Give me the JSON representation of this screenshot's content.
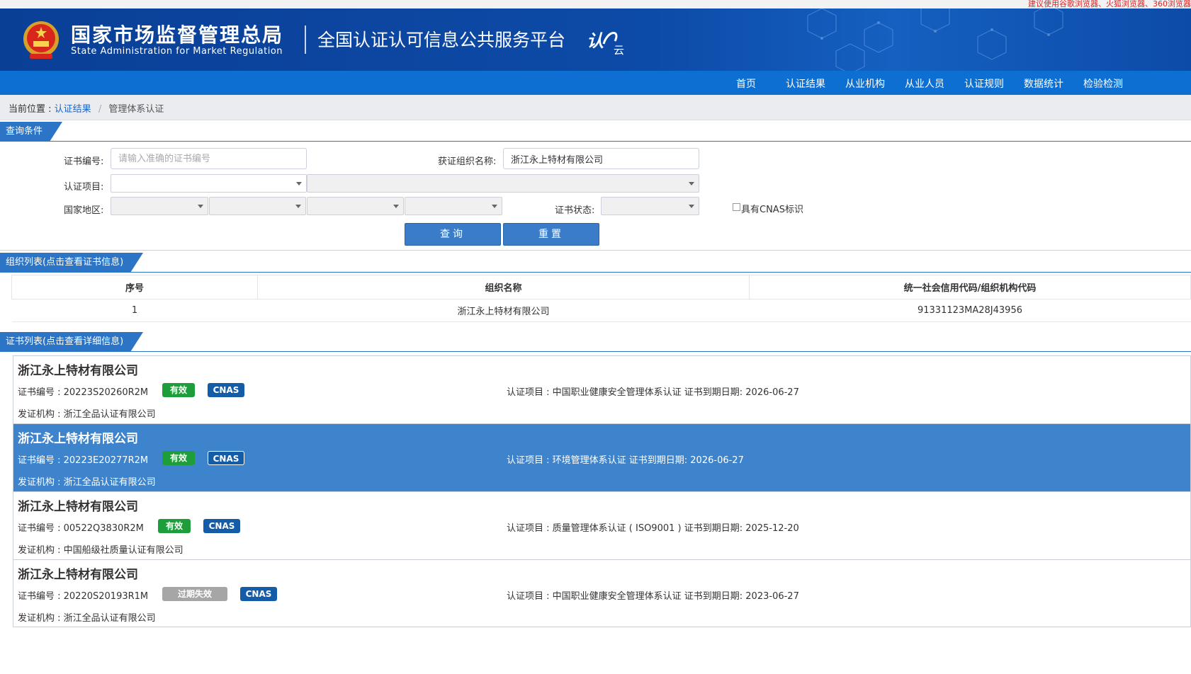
{
  "notice": "建议使用谷歌浏览器、火狐浏览器、360浏览器",
  "header": {
    "org_cn": "国家市场监督管理总局",
    "org_en": "State Administration  for  Market Regulation",
    "platform": "全国认证认可信息公共服务平台",
    "logo_text": "认云"
  },
  "nav": [
    "首页",
    "认证结果",
    "从业机构",
    "从业人员",
    "认证规则",
    "数据统计",
    "检验检测"
  ],
  "breadcrumb": {
    "label": "当前位置 :",
    "link": "认证结果",
    "separator": "/",
    "current": "管理体系认证"
  },
  "query": {
    "section_title": "查询条件",
    "cert_no_label": "证书编号:",
    "cert_no_placeholder": "请输入准确的证书编号",
    "org_name_label": "获证组织名称:",
    "org_name_value": "浙江永上特材有限公司",
    "project_label": "认证项目:",
    "region_label": "国家地区:",
    "status_label": "证书状态:",
    "cnas_label": "具有CNAS标识",
    "search_button": "查询",
    "reset_button": "重置"
  },
  "org_list": {
    "section_title": "组织列表(点击查看证书信息)",
    "columns": [
      "序号",
      "组织名称",
      "统一社会信用代码/组织机构代码"
    ],
    "rows": [
      {
        "index": "1",
        "name": "浙江永上特材有限公司",
        "code": "91331123MA28J43956"
      }
    ]
  },
  "cert_list": {
    "section_title": "证书列表(点击查看详细信息)",
    "items": [
      {
        "org": "浙江永上特材有限公司",
        "cert_no": "证书编号 : 20223S20260R2M",
        "status": "有效",
        "cnas": "CNAS",
        "issuer": "发证机构 : 浙江全品认证有限公司",
        "project": "认证项目 : 中国职业健康安全管理体系认证   证书到期日期: 2026-06-27"
      },
      {
        "org": "浙江永上特材有限公司",
        "cert_no": "证书编号 : 20223E20277R2M",
        "status": "有效",
        "cnas": "CNAS",
        "issuer": "发证机构 : 浙江全品认证有限公司",
        "project": "认证项目 : 环境管理体系认证   证书到期日期: 2026-06-27"
      },
      {
        "org": "浙江永上特材有限公司",
        "cert_no": "证书编号 : 00522Q3830R2M",
        "status": "有效",
        "cnas": "CNAS",
        "issuer": "发证机构 : 中国船级社质量认证有限公司",
        "project": "认证项目 : 质量管理体系认证 ( ISO9001 )   证书到期日期: 2025-12-20"
      },
      {
        "org": "浙江永上特材有限公司",
        "cert_no": "证书编号 : 20220S20193R1M",
        "status": "过期失效",
        "cnas": "CNAS",
        "issuer": "发证机构 : 浙江全品认证有限公司",
        "project": "认证项目 : 中国职业健康安全管理体系认证   证书到期日期: 2023-06-27"
      }
    ]
  },
  "colors": {
    "header_blue": "#0d4ba8",
    "nav_blue": "#0d6fd1",
    "accent": "#2b74c6",
    "valid_green": "#1e9e3a",
    "cnas_blue": "#145ba8",
    "selected_row": "#3e84cc"
  }
}
